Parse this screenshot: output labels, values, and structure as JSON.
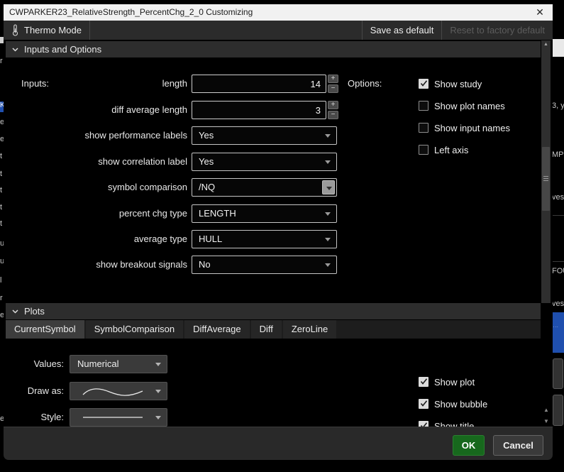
{
  "window": {
    "title": "CWPARKER23_RelativeStrength_PercentChg_2_0 Customizing"
  },
  "toolbar": {
    "thermo_mode": "Thermo Mode",
    "save_as_default": "Save as default",
    "reset_to_factory": "Reset to factory default"
  },
  "sections": {
    "inputs_and_options": "Inputs and Options",
    "plots": "Plots"
  },
  "inputs": {
    "column_label": "Inputs:",
    "rows": [
      {
        "label": "length",
        "type": "number",
        "value": "14"
      },
      {
        "label": "diff average length",
        "type": "number",
        "value": "3"
      },
      {
        "label": "show performance labels",
        "type": "select",
        "value": "Yes"
      },
      {
        "label": "show correlation label",
        "type": "select",
        "value": "Yes"
      },
      {
        "label": "symbol comparison",
        "type": "combo",
        "value": "/NQ"
      },
      {
        "label": "percent chg type",
        "type": "select",
        "value": "LENGTH"
      },
      {
        "label": "average type",
        "type": "select",
        "value": "HULL"
      },
      {
        "label": "show breakout signals",
        "type": "select",
        "value": "No"
      }
    ]
  },
  "options": {
    "column_label": "Options:",
    "checkboxes": [
      {
        "label": "Show study",
        "checked": true
      },
      {
        "label": "Show plot names",
        "checked": false
      },
      {
        "label": "Show input names",
        "checked": false
      },
      {
        "label": "Left axis",
        "checked": false
      }
    ]
  },
  "plots": {
    "tabs": [
      {
        "label": "CurrentSymbol",
        "active": true
      },
      {
        "label": "SymbolComparison",
        "active": false
      },
      {
        "label": "DiffAverage",
        "active": false
      },
      {
        "label": "Diff",
        "active": false
      },
      {
        "label": "ZeroLine",
        "active": false
      }
    ],
    "fields": {
      "values_label": "Values:",
      "values_value": "Numerical",
      "draw_as_label": "Draw as:",
      "style_label": "Style:"
    },
    "checkboxes": [
      {
        "label": "Show plot",
        "checked": true
      },
      {
        "label": "Show bubble",
        "checked": true
      },
      {
        "label": "Show title",
        "checked": true
      }
    ]
  },
  "footer": {
    "ok": "OK",
    "cancel": "Cancel"
  },
  "icons": {
    "close": "✕",
    "plus": "+",
    "minus": "−",
    "up_arrow": "▲",
    "down_arrow": "▼"
  },
  "colors": {
    "ok_green": "#17681d",
    "titlebar": "#f1f1f1",
    "header_bar": "#2d2d2d",
    "highlight_blue": "#1f4fae"
  },
  "background": {
    "left_fragments": [
      "r",
      "el",
      "el",
      "t",
      "t",
      "t",
      "t",
      "t",
      "u",
      "u",
      "l",
      "r",
      "el",
      "e"
    ],
    "left_highlight_fragment": "K",
    "right_fragments": [
      "3, y",
      "MP",
      "ves",
      "FOU",
      "ves"
    ],
    "blue_row_fragment": "····"
  }
}
